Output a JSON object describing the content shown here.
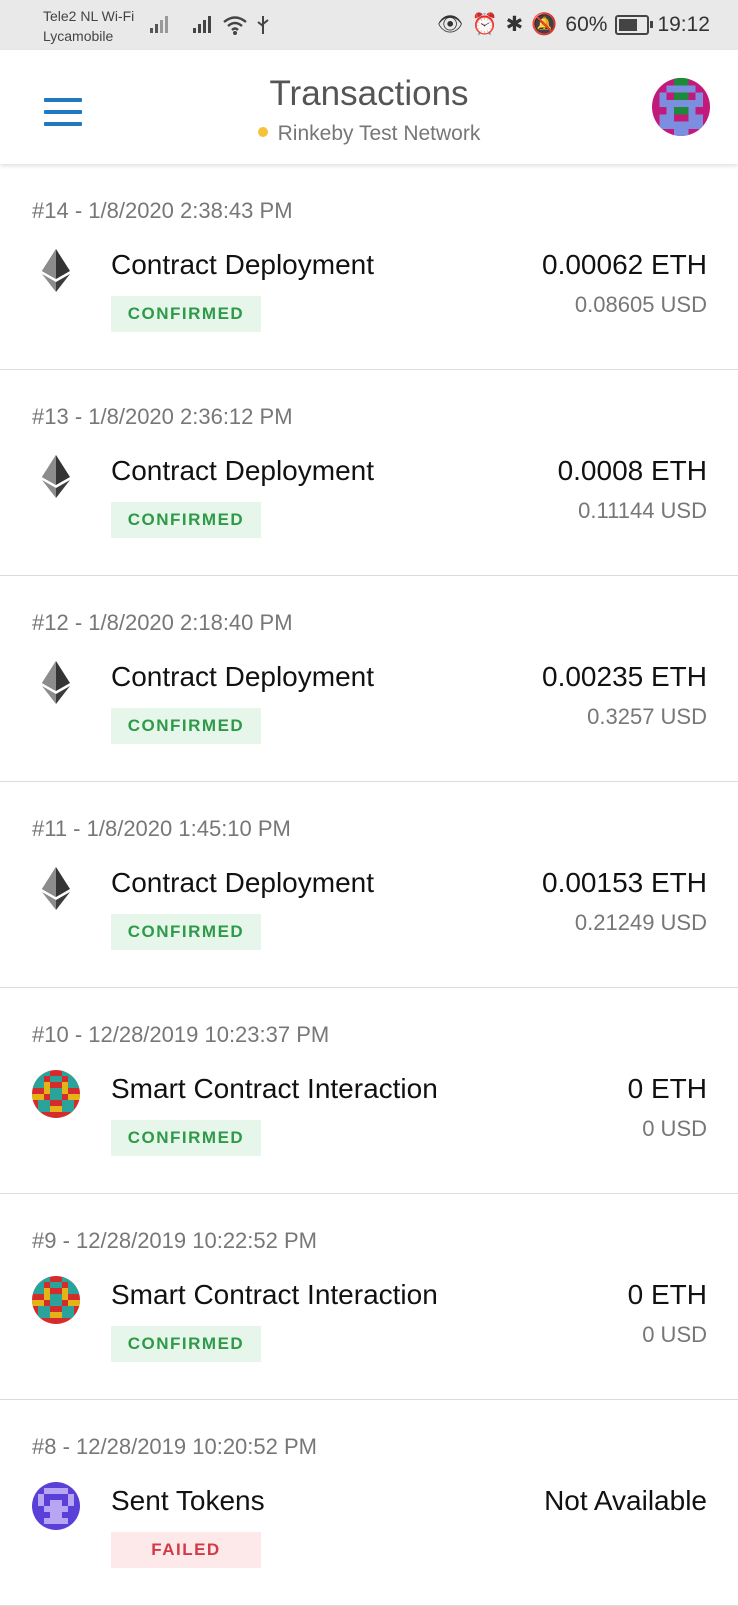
{
  "status_bar": {
    "carrier_line1": "Tele2 NL Wi-Fi",
    "carrier_line2": "Lycamobile",
    "battery": "60%",
    "time": "19:12",
    "icons": [
      "eye-icon",
      "alarm-icon",
      "bluetooth-icon",
      "mute-bell-icon",
      "battery-icon"
    ]
  },
  "header": {
    "title": "Transactions",
    "network": "Rinkeby Test Network",
    "network_dot_color": "#f5c338",
    "menu_color": "#1f78c1"
  },
  "transactions": [
    {
      "head": "#14  - 1/8/2020 2:38:43 PM",
      "icon": "ethereum-icon",
      "type": "Contract Deployment",
      "status": "CONFIRMED",
      "eth": "0.00062 ETH",
      "usd": "0.08605 USD"
    },
    {
      "head": "#13  - 1/8/2020 2:36:12 PM",
      "icon": "ethereum-icon",
      "type": "Contract Deployment",
      "status": "CONFIRMED",
      "eth": "0.0008 ETH",
      "usd": "0.11144 USD"
    },
    {
      "head": "#12  - 1/8/2020 2:18:40 PM",
      "icon": "ethereum-icon",
      "type": "Contract Deployment",
      "status": "CONFIRMED",
      "eth": "0.00235 ETH",
      "usd": "0.3257 USD"
    },
    {
      "head": "#11  - 1/8/2020 1:45:10 PM",
      "icon": "ethereum-icon",
      "type": "Contract Deployment",
      "status": "CONFIRMED",
      "eth": "0.00153 ETH",
      "usd": "0.21249 USD"
    },
    {
      "head": "#10  - 12/28/2019 10:23:37 PM",
      "icon": "contract-identicon-icon",
      "type": "Smart Contract Interaction",
      "status": "CONFIRMED",
      "eth": "0 ETH",
      "usd": "0 USD"
    },
    {
      "head": "#9  - 12/28/2019 10:22:52 PM",
      "icon": "contract-identicon-icon",
      "type": "Smart Contract Interaction",
      "status": "CONFIRMED",
      "eth": "0 ETH",
      "usd": "0 USD"
    },
    {
      "head": "#8  - 12/28/2019 10:20:52 PM",
      "icon": "token-identicon-icon",
      "type": "Sent Tokens",
      "status": "FAILED",
      "eth": "Not Available",
      "usd": ""
    }
  ]
}
